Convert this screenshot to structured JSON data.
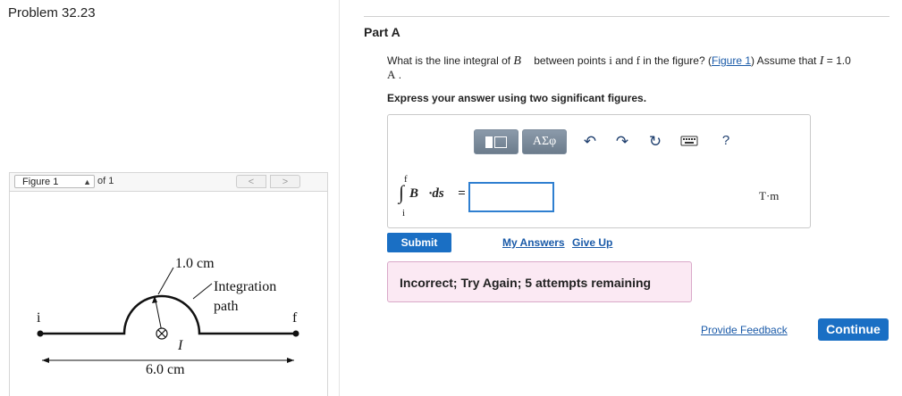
{
  "problem": {
    "title": "Problem 32.23"
  },
  "figure_panel": {
    "select_label": "Figure 1",
    "of_label": "of 1",
    "prev": "<",
    "next": ">",
    "labels": {
      "radius": "1.0 cm",
      "integration_line1": "Integration",
      "integration_line2": "path",
      "point_i": "i",
      "point_f": "f",
      "current": "I",
      "width": "6.0 cm"
    }
  },
  "part": {
    "label": "Part A",
    "question": {
      "before_vec": "What is the line integral of ",
      "vec_symbol": "B",
      "between": " between points ",
      "point_i": "i",
      "and": " and ",
      "point_f": "f",
      "in_figure": " in the figure? (",
      "figure_link": "Figure 1",
      "assume": ") Assume that ",
      "current_var": "I",
      "equals": " = 1.0",
      "unit": "A"
    },
    "instruction": "Express your answer using two significant figures."
  },
  "answer": {
    "toolbar": {
      "greek_label": "ΑΣφ",
      "icons": [
        "templates-icon",
        "undo-icon",
        "redo-icon",
        "reset-icon",
        "keyboard-icon",
        "help-icon"
      ],
      "help_label": "?"
    },
    "integral_upper": "f",
    "integral_lower": "i",
    "integral_expr": "B⃗·ds⃗ =",
    "input_value": "",
    "units": "T·m"
  },
  "actions": {
    "submit": "Submit",
    "my_answers": "My Answers",
    "give_up": "Give Up",
    "feedback_message": "Incorrect; Try Again; 5 attempts remaining",
    "provide_feedback": "Provide Feedback",
    "continue": "Continue"
  },
  "colors": {
    "primary_button": "#1a6fc4",
    "link": "#1a5aa8",
    "feedback_bg": "#fbe9f3",
    "feedback_border": "#d9a9c9",
    "input_border": "#2f7fd0"
  }
}
